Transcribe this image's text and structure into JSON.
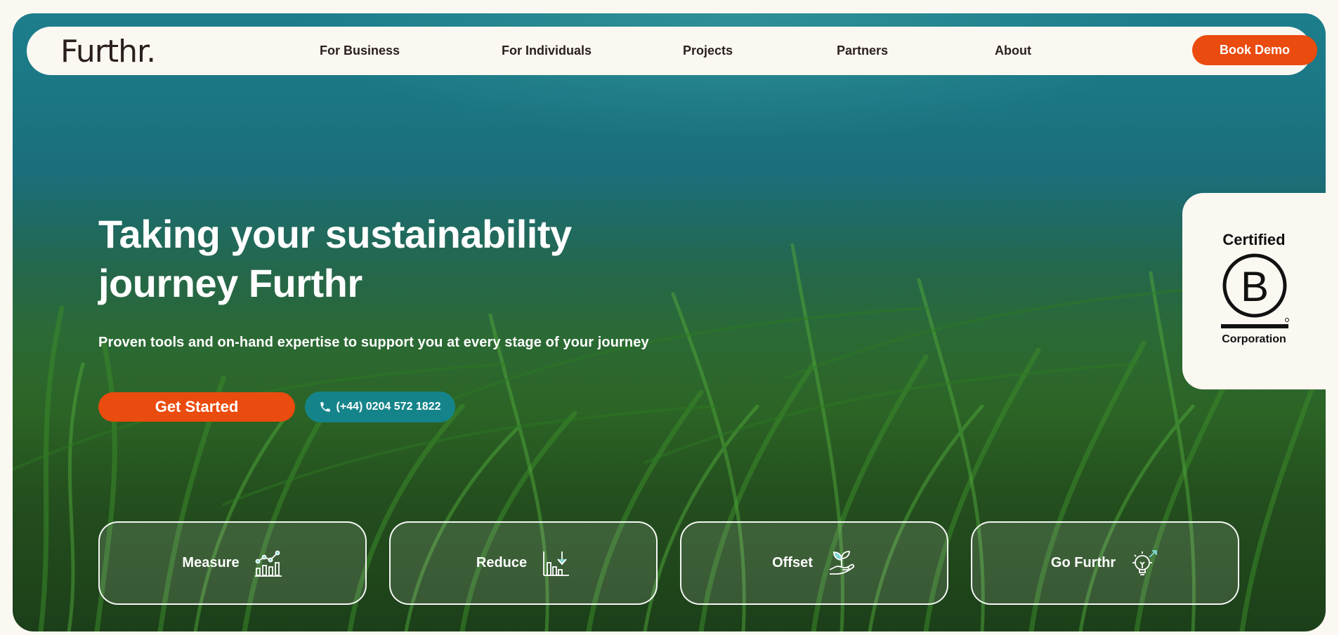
{
  "brand": {
    "logo_text": "Furthr."
  },
  "nav": {
    "items": [
      {
        "label": "For Business"
      },
      {
        "label": "For Individuals"
      },
      {
        "label": "Projects"
      },
      {
        "label": "Partners"
      },
      {
        "label": "About"
      }
    ],
    "cta_label": "Book Demo"
  },
  "hero": {
    "headline_line1": "Taking your sustainability",
    "headline_line2": "journey Furthr",
    "subheadline": "Proven tools and on-hand expertise to support you at every stage of your journey",
    "primary_cta": "Get Started",
    "phone_cta": "(+44) 0204 572 1822",
    "phone_icon": "phone-icon"
  },
  "certification": {
    "line1": "Certified",
    "logo_letter": "B",
    "line2": "Corporation"
  },
  "cards": [
    {
      "label": "Measure",
      "icon": "chart-network-icon"
    },
    {
      "label": "Reduce",
      "icon": "chart-down-arrow-icon"
    },
    {
      "label": "Offset",
      "icon": "hand-plant-icon"
    },
    {
      "label": "Go Furthr",
      "icon": "lightbulb-arrow-icon"
    }
  ],
  "colors": {
    "accent_orange": "#ea4b0e",
    "accent_teal": "#15848a",
    "cream": "#fbf8f2",
    "dark_text": "#2a1f1d"
  }
}
